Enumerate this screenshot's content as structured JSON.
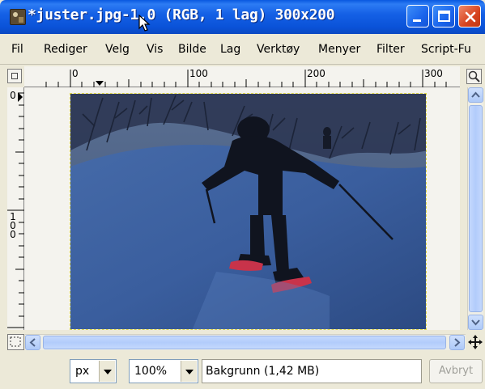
{
  "window": {
    "title": "*juster.jpg-1.0 (RGB, 1 lag) 300x200"
  },
  "menubar": {
    "items": [
      "Fil",
      "Rediger",
      "Velg",
      "Vis",
      "Bilde",
      "Lag",
      "Verktøy",
      "Menyer",
      "Filter",
      "Script-Fu"
    ]
  },
  "ruler": {
    "h_labels": [
      "0",
      "100",
      "200",
      "300"
    ],
    "v_labels": [
      "0",
      "1\n0\n0"
    ]
  },
  "statusbar": {
    "unit": "px",
    "zoom": "100%",
    "layer_info": "Bakgrunn (1,42 MB)",
    "cancel_label": "Avbryt"
  },
  "colors": {
    "titlebar": "#0a52d8",
    "selection_border": "#dfd74a",
    "snow": "#3c5e9a"
  },
  "icons": [
    "gimp-image-icon",
    "minimize-icon",
    "maximize-icon",
    "close-icon",
    "mouse-cursor-icon",
    "quick-mask-icon",
    "zoom-icon",
    "scroll-up-icon",
    "scroll-down-icon",
    "scroll-left-icon",
    "scroll-right-icon",
    "navigate-icon",
    "move-icon"
  ]
}
